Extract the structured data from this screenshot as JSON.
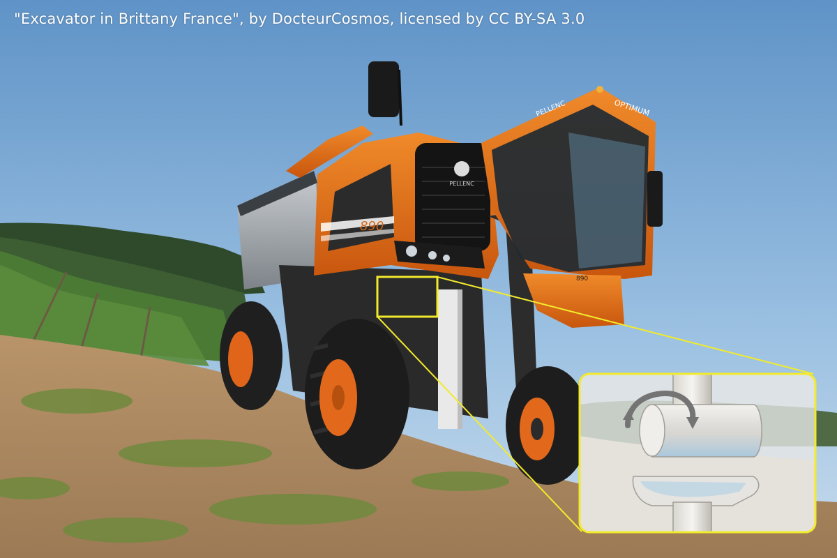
{
  "caption": "\"Excavator in Brittany France\", by DocteurCosmos, licensed by CC BY-SA 3.0",
  "machine": {
    "cab_brand": "PELLENC",
    "cab_model": "OPTIMUM",
    "hood_logo": "PELLENC",
    "model_number": "890"
  },
  "inset": {
    "description": "zoomed inset of joint",
    "rotation_arrow": "rotation-arrow-icon"
  },
  "colors": {
    "machine_orange": "#e8741a",
    "highlight_yellow": "#f2ea2c",
    "sky": "#8fb7dc"
  }
}
